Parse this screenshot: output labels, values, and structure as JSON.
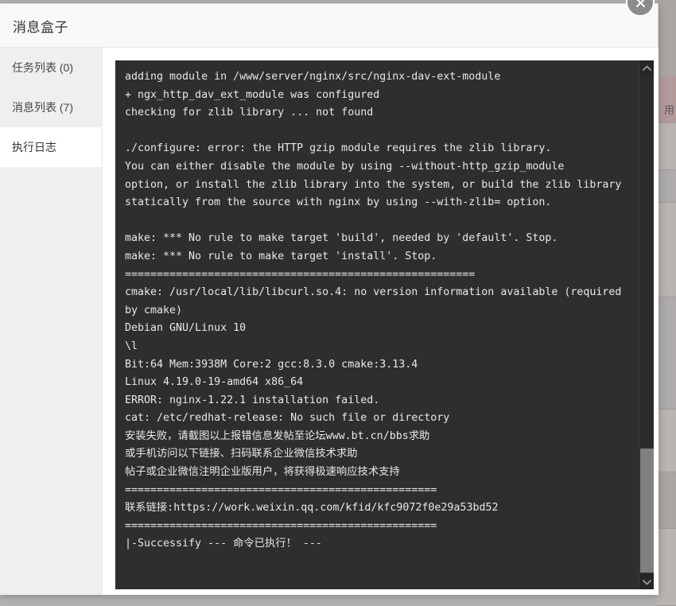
{
  "modal": {
    "title": "消息盒子",
    "close_label": "×"
  },
  "sidebar": {
    "items": [
      {
        "label": "任务列表 (0)",
        "active": false
      },
      {
        "label": "消息列表 (7)",
        "active": false
      },
      {
        "label": "执行日志",
        "active": true
      }
    ]
  },
  "log": {
    "content": "adding module in /www/server/nginx/src/nginx-dav-ext-module\n+ ngx_http_dav_ext_module was configured\nchecking for zlib library ... not found\n\n./configure: error: the HTTP gzip module requires the zlib library.\nYou can either disable the module by using --without-http_gzip_module\noption, or install the zlib library into the system, or build the zlib library\nstatically from the source with nginx by using --with-zlib= option.\n\nmake: *** No rule to make target 'build', needed by 'default'. Stop.\nmake: *** No rule to make target 'install'. Stop.\n=======================================================\ncmake: /usr/local/lib/libcurl.so.4: no version information available (required by cmake)\nDebian GNU/Linux 10\n\\l\nBit:64 Mem:3938M Core:2 gcc:8.3.0 cmake:3.13.4\nLinux 4.19.0-19-amd64 x86_64\nERROR: nginx-1.22.1 installation failed.\ncat: /etc/redhat-release: No such file or directory\n安装失败，请截图以上报错信息发帖至论坛www.bt.cn/bbs求助\n或手机访问以下链接、扫码联系企业微信技术求助\n帖子或企业微信注明企业版用户，将获得极速响应技术支持\n=================================================\n联系链接:https://work.weixin.qq.com/kfid/kfc9072f0e29a53bd52\n=================================================\n|-Successify --- 命令已执行！ ---",
    "scrollbar": {
      "up_arrow": "scroll-up",
      "down_arrow": "scroll-down"
    }
  },
  "background": {
    "fragment_text": "用",
    "colors": {
      "overlay": "#b3b3b3",
      "panel_dark": "#2e2e2e",
      "sidebar": "#efefef",
      "header": "#f8f8f8",
      "scroll_thumb": "#808080"
    }
  }
}
